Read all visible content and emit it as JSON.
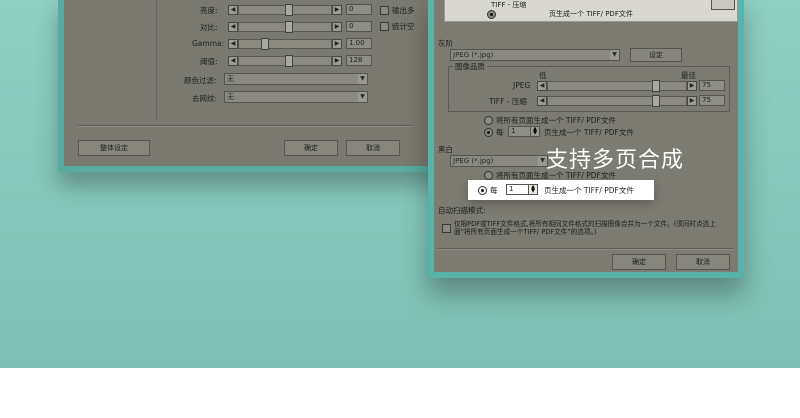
{
  "overlay_caption": "支持多页合成",
  "left_dialog": {
    "labels": {
      "brightness": "亮度:",
      "contrast": "对比:",
      "gamma": "Gamma:",
      "threshold": "阈值:",
      "color_filter": "颜色过滤:",
      "descreen": "去网纹:"
    },
    "values": {
      "brightness": "0",
      "contrast": "0",
      "gamma": "1.00",
      "threshold": "128"
    },
    "combos": {
      "color_filter": "无",
      "descreen": "无"
    },
    "checkboxes": [
      "输出多",
      "统计空"
    ],
    "buttons": {
      "overall_settings": "整体设定",
      "ok": "确定",
      "cancel": "取消"
    }
  },
  "right_dialog": {
    "top_strip": {
      "label": "TIFF - 压缩",
      "radio_text": "页生成一个 TIFF/ PDF文件"
    },
    "gray_section": {
      "title": "灰阶",
      "format": "JPEG (*.jpg)",
      "settings_button": "设定",
      "quality_title": "图像品质",
      "low": "低",
      "high": "最佳",
      "jpeg_label": "JPEG",
      "jpeg_value": "75",
      "tiff_label": "TIFF - 压缩",
      "tiff_value": "75",
      "option_all": "将所有页面生成一个 TIFF/ PDF文件",
      "option_each_prefix": "每",
      "option_each_value": "1",
      "option_each_suffix": "页生成一个 TIFF/ PDF文件"
    },
    "bw_section": {
      "title": "黑白",
      "format": "JPEG (*.jpg)",
      "option_all": "将所有页面生成一个 TIFF/ PDF文件",
      "option_each_prefix": "每",
      "option_each_value": "1",
      "option_each_suffix": "页生成一个 TIFF/ PDF文件"
    },
    "auto_scan": {
      "title": "自动扫描模式:",
      "checkbox_text": "仅限PDF或TIFF文件格式,将所有相同文件格式的扫描图像合并为一个文件。(须同时点选上面“将所有页面生成一个TIFF/ PDF文件”的选项。)"
    },
    "buttons": {
      "ok": "确定",
      "cancel": "取消"
    }
  },
  "colors": {
    "background": "#8fd1c3",
    "dialog_frame": "#5ab3a8",
    "dialog_body": "#7c7c72",
    "caption": "#ffffff"
  }
}
